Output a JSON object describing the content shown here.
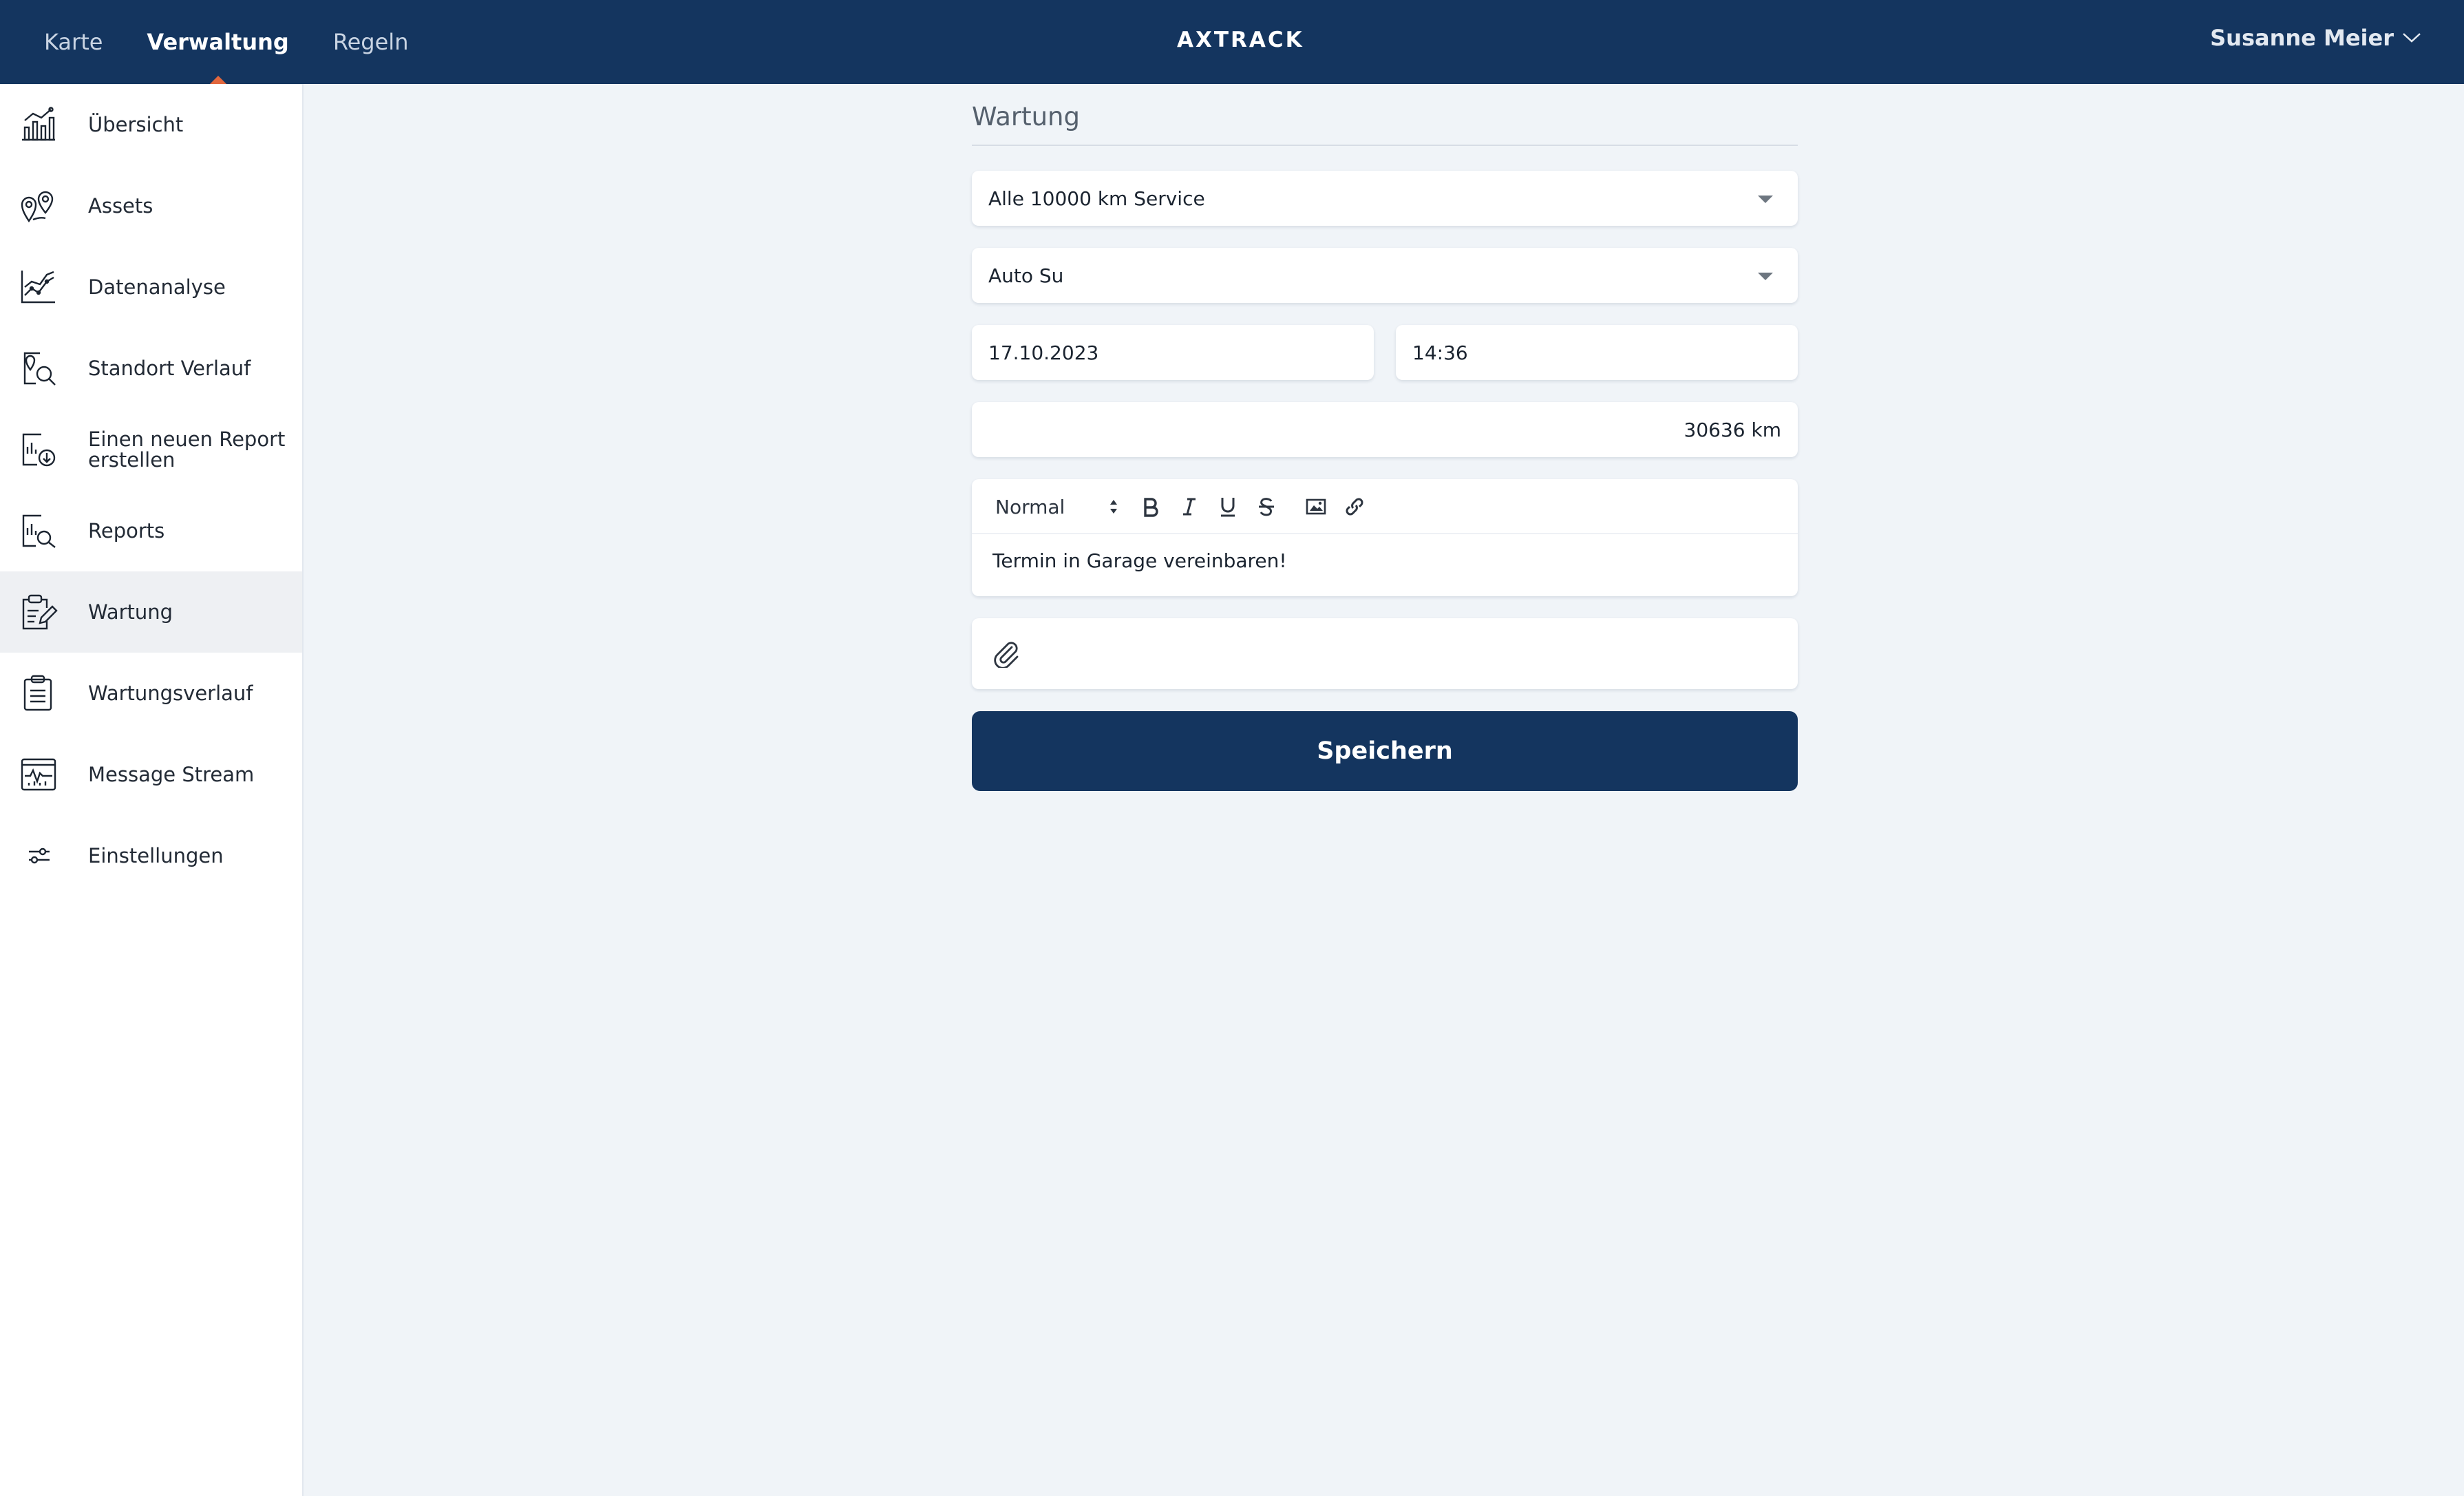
{
  "nav": {
    "items": [
      {
        "label": "Karte",
        "active": false
      },
      {
        "label": "Verwaltung",
        "active": true
      },
      {
        "label": "Regeln",
        "active": false
      }
    ]
  },
  "logo": "AXTRACK",
  "user": {
    "name": "Susanne Meier"
  },
  "sidebar": {
    "items": [
      {
        "label": "Übersicht",
        "icon": "chart-bars-icon"
      },
      {
        "label": "Assets",
        "icon": "map-pin-icon"
      },
      {
        "label": "Datenanalyse",
        "icon": "line-chart-icon"
      },
      {
        "label": "Standort Verlauf",
        "icon": "location-search-icon"
      },
      {
        "label": "Einen neuen Report erstellen",
        "icon": "report-download-icon"
      },
      {
        "label": "Reports",
        "icon": "report-search-icon"
      },
      {
        "label": "Wartung",
        "icon": "clipboard-edit-icon",
        "active": true
      },
      {
        "label": "Wartungsverlauf",
        "icon": "clipboard-list-icon"
      },
      {
        "label": "Message Stream",
        "icon": "monitor-icon"
      },
      {
        "label": "Einstellungen",
        "icon": "sliders-icon"
      }
    ]
  },
  "form": {
    "heading": "Wartung",
    "service_type": "Alle 10000 km Service",
    "asset": "Auto Su",
    "date": "17.10.2023",
    "time": "14:36",
    "mileage": "30636 km",
    "editor": {
      "format": "Normal",
      "text": "Termin in Garage vereinbaren!"
    },
    "save_label": "Speichern"
  },
  "colors": {
    "primary": "#14355f",
    "accent": "#e2673d",
    "background": "#f0f4f8"
  }
}
